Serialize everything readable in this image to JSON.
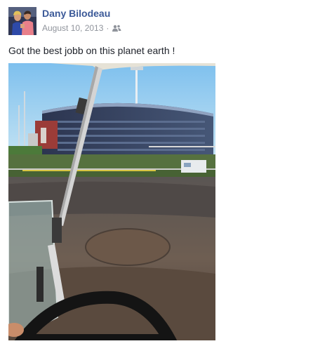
{
  "post": {
    "author": "Dany Bilodeau",
    "date": "August 10, 2013",
    "separator": "·",
    "audience_icon": "friends-icon",
    "message": "Got the best jobb on this planet earth !",
    "avatar_icon": "profile-photo",
    "photo": "photo-of-arena-from-golf-cart"
  },
  "colors": {
    "author_link": "#3b5998",
    "meta_text": "#90949c",
    "message_text": "#1d2129"
  }
}
